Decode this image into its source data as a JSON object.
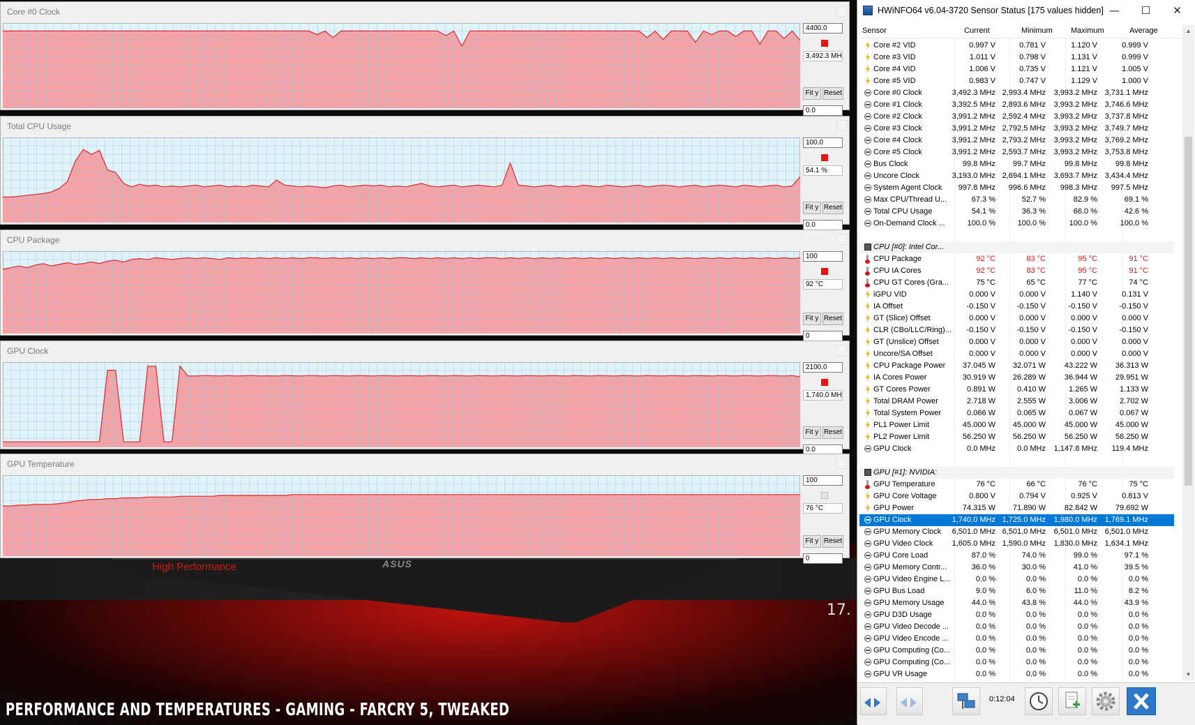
{
  "caption": "Performance and temperatures - Gaming - FarCry 5, tweaked",
  "background": {
    "mode_label": "High Performance",
    "brand": "ASUS",
    "corner_number": "17."
  },
  "graphs": [
    {
      "title": "Core #0 Clock",
      "max": "4400.0",
      "current": "3,492.3 MH",
      "min": "0.0",
      "fit": "Fit y",
      "reset": "Reset",
      "enabled": true,
      "series_max": 4400,
      "series": [
        3990,
        3990,
        3990,
        3990,
        3990,
        3990,
        3990,
        3990,
        3990,
        3990,
        3990,
        3990,
        3990,
        3990,
        3990,
        3990,
        3990,
        3990,
        3990,
        3990,
        3990,
        3990,
        3990,
        3990,
        3990,
        3990,
        3990,
        3990,
        3990,
        3990,
        3990,
        3990,
        3990,
        3990,
        3990,
        3990,
        3990,
        3990,
        3990,
        3800,
        3990,
        3650,
        3990,
        3990,
        3990,
        3990,
        3990,
        3990,
        3990,
        3990,
        3990,
        3990,
        3990,
        3990,
        3990,
        3750,
        3990,
        3200,
        3990,
        3990,
        3990,
        3990,
        3990,
        3990,
        3990,
        3990,
        3990,
        3990,
        3990,
        3990,
        3990,
        3990,
        3990,
        3990,
        3990,
        3990,
        3990,
        3990,
        3990,
        3990,
        3650,
        3990,
        3550,
        3990,
        3990,
        3990,
        3400,
        3990,
        3800,
        3990,
        3990,
        3700,
        3990,
        3990,
        3300,
        3990,
        3990,
        3600,
        3990,
        3500
      ]
    },
    {
      "title": "Total CPU Usage",
      "max": "100.0",
      "current": "54.1 %",
      "min": "0.0",
      "fit": "Fit y",
      "reset": "Reset",
      "enabled": true,
      "series_max": 100,
      "series": [
        30,
        30,
        31,
        32,
        33,
        34,
        36,
        40,
        48,
        72,
        86,
        80,
        85,
        62,
        59,
        46,
        42,
        45,
        43,
        44,
        42,
        43,
        42,
        43,
        44,
        42,
        43,
        44,
        42,
        43,
        42,
        44,
        43,
        42,
        50,
        44,
        43,
        42,
        43,
        42,
        41,
        43,
        44,
        42,
        43,
        44,
        43,
        44,
        42,
        43,
        42,
        44,
        46,
        43,
        42,
        43,
        44,
        42,
        43,
        44,
        43,
        42,
        44,
        70,
        44,
        43,
        42,
        43,
        44,
        42,
        43,
        42,
        44,
        43,
        42,
        44,
        43,
        42,
        43,
        44,
        42,
        43,
        44,
        43,
        42,
        43,
        44,
        42,
        43,
        44,
        43,
        42,
        44,
        43,
        42,
        43,
        44,
        42,
        43,
        54
      ]
    },
    {
      "title": "CPU Package",
      "max": "100",
      "current": "92 °C",
      "min": "0",
      "fit": "Fit y",
      "reset": "Reset",
      "enabled": true,
      "series_max": 100,
      "series": [
        78,
        80,
        82,
        80,
        83,
        85,
        82,
        84,
        86,
        84,
        85,
        87,
        85,
        88,
        89,
        87,
        90,
        91,
        90,
        92,
        91,
        90,
        91,
        92,
        91,
        92,
        91,
        90,
        92,
        91,
        92,
        91,
        92,
        91,
        92,
        91,
        92,
        91,
        92,
        92,
        91,
        92,
        91,
        92,
        91,
        92,
        91,
        92,
        91,
        92,
        92,
        91,
        92,
        91,
        92,
        91,
        92,
        91,
        92,
        91,
        92,
        92,
        91,
        92,
        91,
        92,
        91,
        92,
        91,
        92,
        91,
        92,
        91,
        92,
        91,
        92,
        91,
        92,
        91,
        92,
        91,
        92,
        91,
        92,
        91,
        92,
        91,
        92,
        91,
        92,
        91,
        92,
        91,
        92,
        91,
        92,
        91,
        92,
        91,
        92
      ]
    },
    {
      "title": "GPU Clock",
      "max": "2100.0",
      "current": "1,740.0 MH",
      "min": "0.0",
      "fit": "Fit y",
      "reset": "Reset",
      "enabled": true,
      "series_max": 2100,
      "series": [
        135,
        135,
        135,
        135,
        135,
        135,
        135,
        135,
        135,
        135,
        135,
        135,
        135,
        1900,
        1900,
        135,
        135,
        135,
        2000,
        2000,
        135,
        135,
        2000,
        1760,
        1760,
        1770,
        1765,
        1760,
        1770,
        1760,
        1765,
        1770,
        1760,
        1765,
        1760,
        1770,
        1765,
        1760,
        1770,
        1765,
        1760,
        1770,
        1765,
        1760,
        1770,
        1765,
        1760,
        1770,
        1765,
        1760,
        1770,
        1765,
        1760,
        1770,
        1765,
        1760,
        1770,
        1765,
        1760,
        1770,
        1765,
        1760,
        1770,
        1765,
        1760,
        1770,
        1765,
        1760,
        1770,
        1765,
        1760,
        1770,
        1765,
        1760,
        1770,
        1765,
        1760,
        1770,
        1765,
        1760,
        1770,
        1765,
        1760,
        1770,
        1765,
        1760,
        1770,
        1765,
        1760,
        1770,
        1765,
        1760,
        1770,
        1765,
        1760,
        1770,
        1765,
        1760,
        1770,
        1740
      ]
    },
    {
      "title": "GPU Temperature",
      "max": "100",
      "current": "76 °C",
      "min": "0",
      "fit": "Fit y",
      "reset": "Reset",
      "enabled": false,
      "series_max": 100,
      "series": [
        62,
        62,
        63,
        63,
        64,
        64,
        64,
        65,
        66,
        68,
        69,
        70,
        70,
        71,
        71,
        72,
        72,
        72,
        73,
        73,
        73,
        73,
        74,
        74,
        74,
        74,
        74,
        75,
        75,
        75,
        75,
        75,
        75,
        75,
        75,
        75,
        76,
        76,
        76,
        76,
        76,
        76,
        76,
        76,
        76,
        76,
        76,
        76,
        76,
        76,
        76,
        76,
        76,
        76,
        76,
        76,
        76,
        76,
        76,
        76,
        76,
        76,
        76,
        76,
        76,
        76,
        76,
        76,
        76,
        76,
        76,
        76,
        76,
        76,
        76,
        76,
        76,
        76,
        76,
        76,
        76,
        76,
        76,
        76,
        76,
        76,
        76,
        76,
        76,
        76,
        76,
        76,
        76,
        76,
        76,
        76,
        76,
        76,
        76,
        76
      ]
    }
  ],
  "hwinfo": {
    "title": "HWiNFO64 v6.04-3720 Sensor Status [175 values hidden]",
    "columns": [
      "Sensor",
      "Current",
      "Minimum",
      "Maximum",
      "Average"
    ],
    "rows": [
      {
        "icon": "volt",
        "name": "Core #2 VID",
        "cur": "0.997 V",
        "min": "0.781 V",
        "max": "1.120 V",
        "avg": "0.999 V"
      },
      {
        "icon": "volt",
        "name": "Core #3 VID",
        "cur": "1.011 V",
        "min": "0.798 V",
        "max": "1.131 V",
        "avg": "0.999 V"
      },
      {
        "icon": "volt",
        "name": "Core #4 VID",
        "cur": "1.006 V",
        "min": "0.735 V",
        "max": "1.121 V",
        "avg": "1.005 V"
      },
      {
        "icon": "volt",
        "name": "Core #5 VID",
        "cur": "0.983 V",
        "min": "0.747 V",
        "max": "1.129 V",
        "avg": "1.000 V"
      },
      {
        "icon": "clock",
        "name": "Core #0 Clock",
        "cur": "3,492.3 MHz",
        "min": "2,993.4 MHz",
        "max": "3,993.2 MHz",
        "avg": "3,731.1 MHz"
      },
      {
        "icon": "clock",
        "name": "Core #1 Clock",
        "cur": "3,392.5 MHz",
        "min": "2,893.6 MHz",
        "max": "3,993.2 MHz",
        "avg": "3,746.6 MHz"
      },
      {
        "icon": "clock",
        "name": "Core #2 Clock",
        "cur": "3,991.2 MHz",
        "min": "2,592.4 MHz",
        "max": "3,993.2 MHz",
        "avg": "3,737.8 MHz"
      },
      {
        "icon": "clock",
        "name": "Core #3 Clock",
        "cur": "3,991.2 MHz",
        "min": "2,792.5 MHz",
        "max": "3,993.2 MHz",
        "avg": "3,749.7 MHz"
      },
      {
        "icon": "clock",
        "name": "Core #4 Clock",
        "cur": "3,991.2 MHz",
        "min": "2,793.2 MHz",
        "max": "3,993.2 MHz",
        "avg": "3,769.2 MHz"
      },
      {
        "icon": "clock",
        "name": "Core #5 Clock",
        "cur": "3,991.2 MHz",
        "min": "2,593.7 MHz",
        "max": "3,993.2 MHz",
        "avg": "3,753.8 MHz"
      },
      {
        "icon": "clock",
        "name": "Bus Clock",
        "cur": "99.8 MHz",
        "min": "99.7 MHz",
        "max": "99.8 MHz",
        "avg": "99.8 MHz"
      },
      {
        "icon": "clock",
        "name": "Uncore Clock",
        "cur": "3,193.0 MHz",
        "min": "2,694.1 MHz",
        "max": "3,693.7 MHz",
        "avg": "3,434.4 MHz"
      },
      {
        "icon": "clock",
        "name": "System Agent Clock",
        "cur": "997.8 MHz",
        "min": "996.6 MHz",
        "max": "998.3 MHz",
        "avg": "997.5 MHz"
      },
      {
        "icon": "clock",
        "name": "Max CPU/Thread U...",
        "cur": "67.3 %",
        "min": "52.7 %",
        "max": "82.9 %",
        "avg": "69.1 %"
      },
      {
        "icon": "clock",
        "name": "Total CPU Usage",
        "cur": "54.1 %",
        "min": "36.3 %",
        "max": "66.0 %",
        "avg": "42.6 %"
      },
      {
        "icon": "clock",
        "name": "On-Demand Clock ...",
        "cur": "100.0 %",
        "min": "100.0 %",
        "max": "100.0 %",
        "avg": "100.0 %"
      },
      {
        "icon": "blank",
        "name": "",
        "cur": "",
        "min": "",
        "max": "",
        "avg": ""
      },
      {
        "icon": "chip",
        "name": "CPU [#0]: Intel Cor...",
        "cur": "",
        "min": "",
        "max": "",
        "avg": "",
        "group": true
      },
      {
        "icon": "therm",
        "name": "CPU Package",
        "cur": "92 °C",
        "min": "83 °C",
        "max": "95 °C",
        "avg": "91 °C",
        "hot": true
      },
      {
        "icon": "therm",
        "name": "CPU IA Cores",
        "cur": "92 °C",
        "min": "83 °C",
        "max": "95 °C",
        "avg": "91 °C",
        "hot": true
      },
      {
        "icon": "therm",
        "name": "CPU GT Cores (Gra...",
        "cur": "75 °C",
        "min": "65 °C",
        "max": "77 °C",
        "avg": "74 °C"
      },
      {
        "icon": "volt",
        "name": "iGPU VID",
        "cur": "0.000 V",
        "min": "0.000 V",
        "max": "1.140 V",
        "avg": "0.131 V"
      },
      {
        "icon": "volt",
        "name": "IA Offset",
        "cur": "-0.150 V",
        "min": "-0.150 V",
        "max": "-0.150 V",
        "avg": "-0.150 V"
      },
      {
        "icon": "volt",
        "name": "GT (Slice) Offset",
        "cur": "0.000 V",
        "min": "0.000 V",
        "max": "0.000 V",
        "avg": "0.000 V"
      },
      {
        "icon": "volt",
        "name": "CLR (CBo/LLC/Ring)...",
        "cur": "-0.150 V",
        "min": "-0.150 V",
        "max": "-0.150 V",
        "avg": "-0.150 V"
      },
      {
        "icon": "volt",
        "name": "GT (Unslice) Offset",
        "cur": "0.000 V",
        "min": "0.000 V",
        "max": "0.000 V",
        "avg": "0.000 V"
      },
      {
        "icon": "volt",
        "name": "Uncore/SA Offset",
        "cur": "0.000 V",
        "min": "0.000 V",
        "max": "0.000 V",
        "avg": "0.000 V"
      },
      {
        "icon": "volt",
        "name": "CPU Package Power",
        "cur": "37.045 W",
        "min": "32.071 W",
        "max": "43.222 W",
        "avg": "36.313 W"
      },
      {
        "icon": "volt",
        "name": "IA Cores Power",
        "cur": "30.919 W",
        "min": "26.289 W",
        "max": "36.944 W",
        "avg": "29.951 W"
      },
      {
        "icon": "volt",
        "name": "GT Cores Power",
        "cur": "0.891 W",
        "min": "0.410 W",
        "max": "1.265 W",
        "avg": "1.133 W"
      },
      {
        "icon": "volt",
        "name": "Total DRAM Power",
        "cur": "2.718 W",
        "min": "2.555 W",
        "max": "3.006 W",
        "avg": "2.702 W"
      },
      {
        "icon": "volt",
        "name": "Total System Power",
        "cur": "0.066 W",
        "min": "0.065 W",
        "max": "0.067 W",
        "avg": "0.067 W"
      },
      {
        "icon": "volt",
        "name": "PL1 Power Limit",
        "cur": "45.000 W",
        "min": "45.000 W",
        "max": "45.000 W",
        "avg": "45.000 W"
      },
      {
        "icon": "volt",
        "name": "PL2 Power Limit",
        "cur": "56.250 W",
        "min": "56.250 W",
        "max": "56.250 W",
        "avg": "56.250 W"
      },
      {
        "icon": "clock",
        "name": "GPU Clock",
        "cur": "0.0 MHz",
        "min": "0.0 MHz",
        "max": "1,147.8 MHz",
        "avg": "119.4 MHz"
      },
      {
        "icon": "blank",
        "name": "",
        "cur": "",
        "min": "",
        "max": "",
        "avg": ""
      },
      {
        "icon": "chip",
        "name": "GPU [#1]: NVIDIA:",
        "cur": "",
        "min": "",
        "max": "",
        "avg": "",
        "group": true
      },
      {
        "icon": "therm",
        "name": "GPU Temperature",
        "cur": "76 °C",
        "min": "66 °C",
        "max": "76 °C",
        "avg": "75 °C"
      },
      {
        "icon": "volt",
        "name": "GPU Core Voltage",
        "cur": "0.800 V",
        "min": "0.794 V",
        "max": "0.925 V",
        "avg": "0.813 V"
      },
      {
        "icon": "volt",
        "name": "GPU Power",
        "cur": "74.315 W",
        "min": "71.890 W",
        "max": "82.842 W",
        "avg": "79.692 W"
      },
      {
        "icon": "clock",
        "name": "GPU Clock",
        "cur": "1,740.0 MHz",
        "min": "1,725.0 MHz",
        "max": "1,980.0 MHz",
        "avg": "1,769.1 MHz",
        "selected": true
      },
      {
        "icon": "clock",
        "name": "GPU Memory Clock",
        "cur": "6,501.0 MHz",
        "min": "6,501.0 MHz",
        "max": "6,501.0 MHz",
        "avg": "6,501.0 MHz"
      },
      {
        "icon": "clock",
        "name": "GPU Video Clock",
        "cur": "1,605.0 MHz",
        "min": "1,590.0 MHz",
        "max": "1,830.0 MHz",
        "avg": "1,634.1 MHz"
      },
      {
        "icon": "clock",
        "name": "GPU Core Load",
        "cur": "87.0 %",
        "min": "74.0 %",
        "max": "99.0 %",
        "avg": "97.1 %"
      },
      {
        "icon": "clock",
        "name": "GPU Memory Contr...",
        "cur": "36.0 %",
        "min": "30.0 %",
        "max": "41.0 %",
        "avg": "39.5 %"
      },
      {
        "icon": "clock",
        "name": "GPU Video Engine L...",
        "cur": "0.0 %",
        "min": "0.0 %",
        "max": "0.0 %",
        "avg": "0.0 %"
      },
      {
        "icon": "clock",
        "name": "GPU Bus Load",
        "cur": "9.0 %",
        "min": "6.0 %",
        "max": "11.0 %",
        "avg": "8.2 %"
      },
      {
        "icon": "clock",
        "name": "GPU Memory Usage",
        "cur": "44.0 %",
        "min": "43.8 %",
        "max": "44.0 %",
        "avg": "43.9 %"
      },
      {
        "icon": "clock",
        "name": "GPU D3D Usage",
        "cur": "0.0 %",
        "min": "0.0 %",
        "max": "0.0 %",
        "avg": "0.0 %"
      },
      {
        "icon": "clock",
        "name": "GPU Video Decode ...",
        "cur": "0.0 %",
        "min": "0.0 %",
        "max": "0.0 %",
        "avg": "0.0 %"
      },
      {
        "icon": "clock",
        "name": "GPU Video Encode ...",
        "cur": "0.0 %",
        "min": "0.0 %",
        "max": "0.0 %",
        "avg": "0.0 %"
      },
      {
        "icon": "clock",
        "name": "GPU Computing (Co...",
        "cur": "0.0 %",
        "min": "0.0 %",
        "max": "0.0 %",
        "avg": "0.0 %"
      },
      {
        "icon": "clock",
        "name": "GPU Computing (Co...",
        "cur": "0.0 %",
        "min": "0.0 %",
        "max": "0.0 %",
        "avg": "0.0 %"
      },
      {
        "icon": "clock",
        "name": "GPU VR Usage",
        "cur": "0.0 %",
        "min": "0.0 %",
        "max": "0.0 %",
        "avg": "0.0 %"
      }
    ],
    "elapsed_time": "0:12:04"
  },
  "colors": {
    "graph_fill": "#f5a3a6",
    "graph_line": "#e0262f",
    "graph_bg": "#dff3f8",
    "grid": "#9fc6dc",
    "selection": "#0078d7",
    "hot_text": "#d4181a"
  }
}
